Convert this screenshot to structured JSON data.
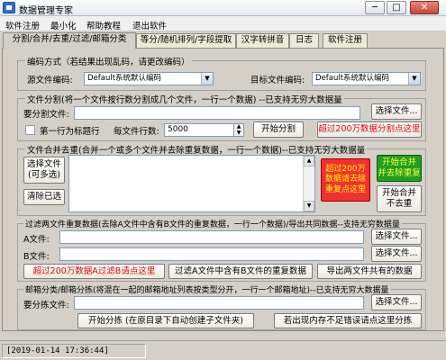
{
  "window": {
    "title": "数据管理专家",
    "minimize": "─",
    "maximize": "□",
    "close": "✕"
  },
  "menu": [
    "软件注册",
    "最小化",
    "帮助教程",
    "退出软件"
  ],
  "tabs": [
    "分割/合并/去重/过滤/邮箱分类",
    "等分/随机排列/字段提取",
    "汉字转拼音",
    "日志",
    "软件注册"
  ],
  "encoding": {
    "legend": "编码方式（若结果出现乱码，请更改编码）",
    "source_label": "源文件编码:",
    "source_value": "Default系统默认编码",
    "target_label": "目标文件编码:",
    "target_value": "Default系统默认编码"
  },
  "split": {
    "legend": "文件分割(将一个文件按行数分割成几个文件，一行一个数据) --已支持无穷大数据量",
    "file_label": "要分割文件:",
    "file_value": "",
    "select_button": "选择文件...",
    "first_row_label": "第一行为标题行",
    "lines_label": "每文件行数:",
    "lines_value": "5000",
    "start_button": "开始分割",
    "over_button": "超过200万数据分割点这里"
  },
  "merge": {
    "legend": "文件合并去重(合并一个或多个文件并去除重复数据，一行一个数据)--已支持无穷大数据量",
    "select_button": "选择文件\n(可多选)",
    "clear_button": "清除已选",
    "over_button": "超过200万\n数据请去除\n重复点这里",
    "merge_dedup_button": "开始合并\n并去除重复",
    "merge_nodedup_button": "开始合并\n不去重"
  },
  "filter": {
    "legend": "过滤两文件重复数据(去除A文件中含有B文件的重复数据，一行一个数据)/导出共同数据--支持无穷数据量",
    "a_label": "A文件:",
    "b_label": "B文件:",
    "select_a_button": "选择文件...",
    "select_b_button": "选择文件...",
    "over_button": "超过200万数据A过滤B请点这里",
    "filter_button": "过滤A文件中含有B文件的重复数据",
    "export_button": "导出两文件共有的数据"
  },
  "email": {
    "legend": "邮箱分类/邮箱分拣(将混在一起的邮箱地址列表按类型分开，一行一个邮箱地址)--已支持无穷大数据量",
    "file_label": "要分拣文件:",
    "select_button": "选择文件...",
    "start_button": "开始分拣 (在原目录下自动创建子文件夹)",
    "memory_button": "若出现内存不足错误请点这里分拣"
  },
  "status": {
    "timestamp": "[2019-01-14 17:36:44]"
  }
}
